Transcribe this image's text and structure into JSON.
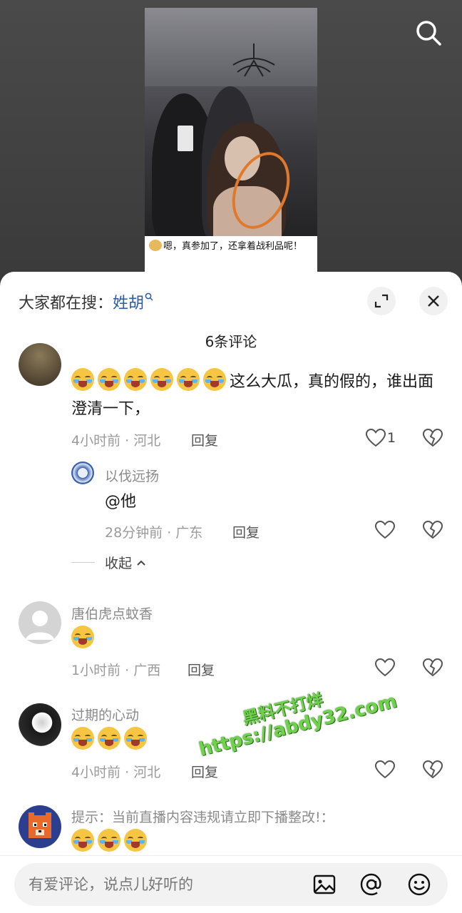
{
  "video": {
    "caption": "嗯，真参加了，还拿着战利品呢！"
  },
  "panel": {
    "trending_prefix": "大家都在搜：",
    "trending_keyword": "姓胡",
    "comment_count": "6条评论",
    "comments": [
      {
        "text": "这么大瓜，真的假的，谁出面澄清一下，",
        "time_location": "4小时前 · 河北",
        "reply_label": "回复",
        "likes": "1",
        "replies": [
          {
            "name": "以伐远扬",
            "text": "@他",
            "time_location": "28分钟前 · 广东",
            "reply_label": "回复"
          }
        ],
        "collapse_label": "收起"
      },
      {
        "name": "唐伯虎点蚊香",
        "time_location": "1小时前 · 广西",
        "reply_label": "回复"
      },
      {
        "name": "过期的心动",
        "time_location": "4小时前 · 河北",
        "reply_label": "回复"
      },
      {
        "name": "提示：当前直播内容违规请立即下播整改!："
      }
    ]
  },
  "watermark": {
    "line1": "黑料不打烊",
    "line2": "https://abdy32.com"
  },
  "input": {
    "placeholder": "有爱评论，说点儿好听的"
  },
  "icons": {
    "search": "search-icon",
    "expand": "expand-icon",
    "close": "close-icon",
    "like": "heart-icon",
    "dislike": "broken-heart-icon",
    "image": "image-icon",
    "mention": "at-icon",
    "emoji": "smile-icon"
  },
  "colors": {
    "keyword": "#2b5aa6",
    "circle_mark": "#e07a2a",
    "watermark": "#6fd14c"
  }
}
